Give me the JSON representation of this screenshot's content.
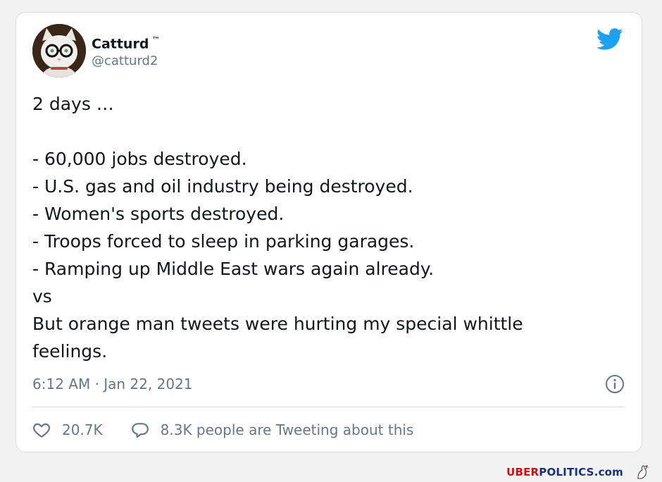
{
  "tweet": {
    "author_name": "Catturd",
    "author_trademark": "™",
    "handle": "@catturd2",
    "text": "2 days …\n\n- 60,000 jobs destroyed.\n- U.S. gas and oil industry being destroyed.\n- Women's sports destroyed.\n- Troops forced to sleep in parking garages.\n- Ramping up Middle East wars again already.\nvs\nBut orange man tweets were hurting my special whittle\nfeelings.",
    "timestamp": "6:12 AM · Jan 22, 2021",
    "like_count": "20.7K",
    "reply_text": "8.3K people are Tweeting about this"
  },
  "icons": {
    "brand": "twitter-bird-icon",
    "info": "info-icon",
    "like": "heart-icon",
    "reply": "speech-bubble-icon"
  },
  "watermark": {
    "part1": "UBER",
    "part2": "POLITICS.com"
  },
  "colors": {
    "twitter_blue": "#1da1f2",
    "muted_text": "#657786",
    "primary_text": "#14171a",
    "watermark_red": "#d40b0b",
    "watermark_blue": "#1c2f7a"
  }
}
